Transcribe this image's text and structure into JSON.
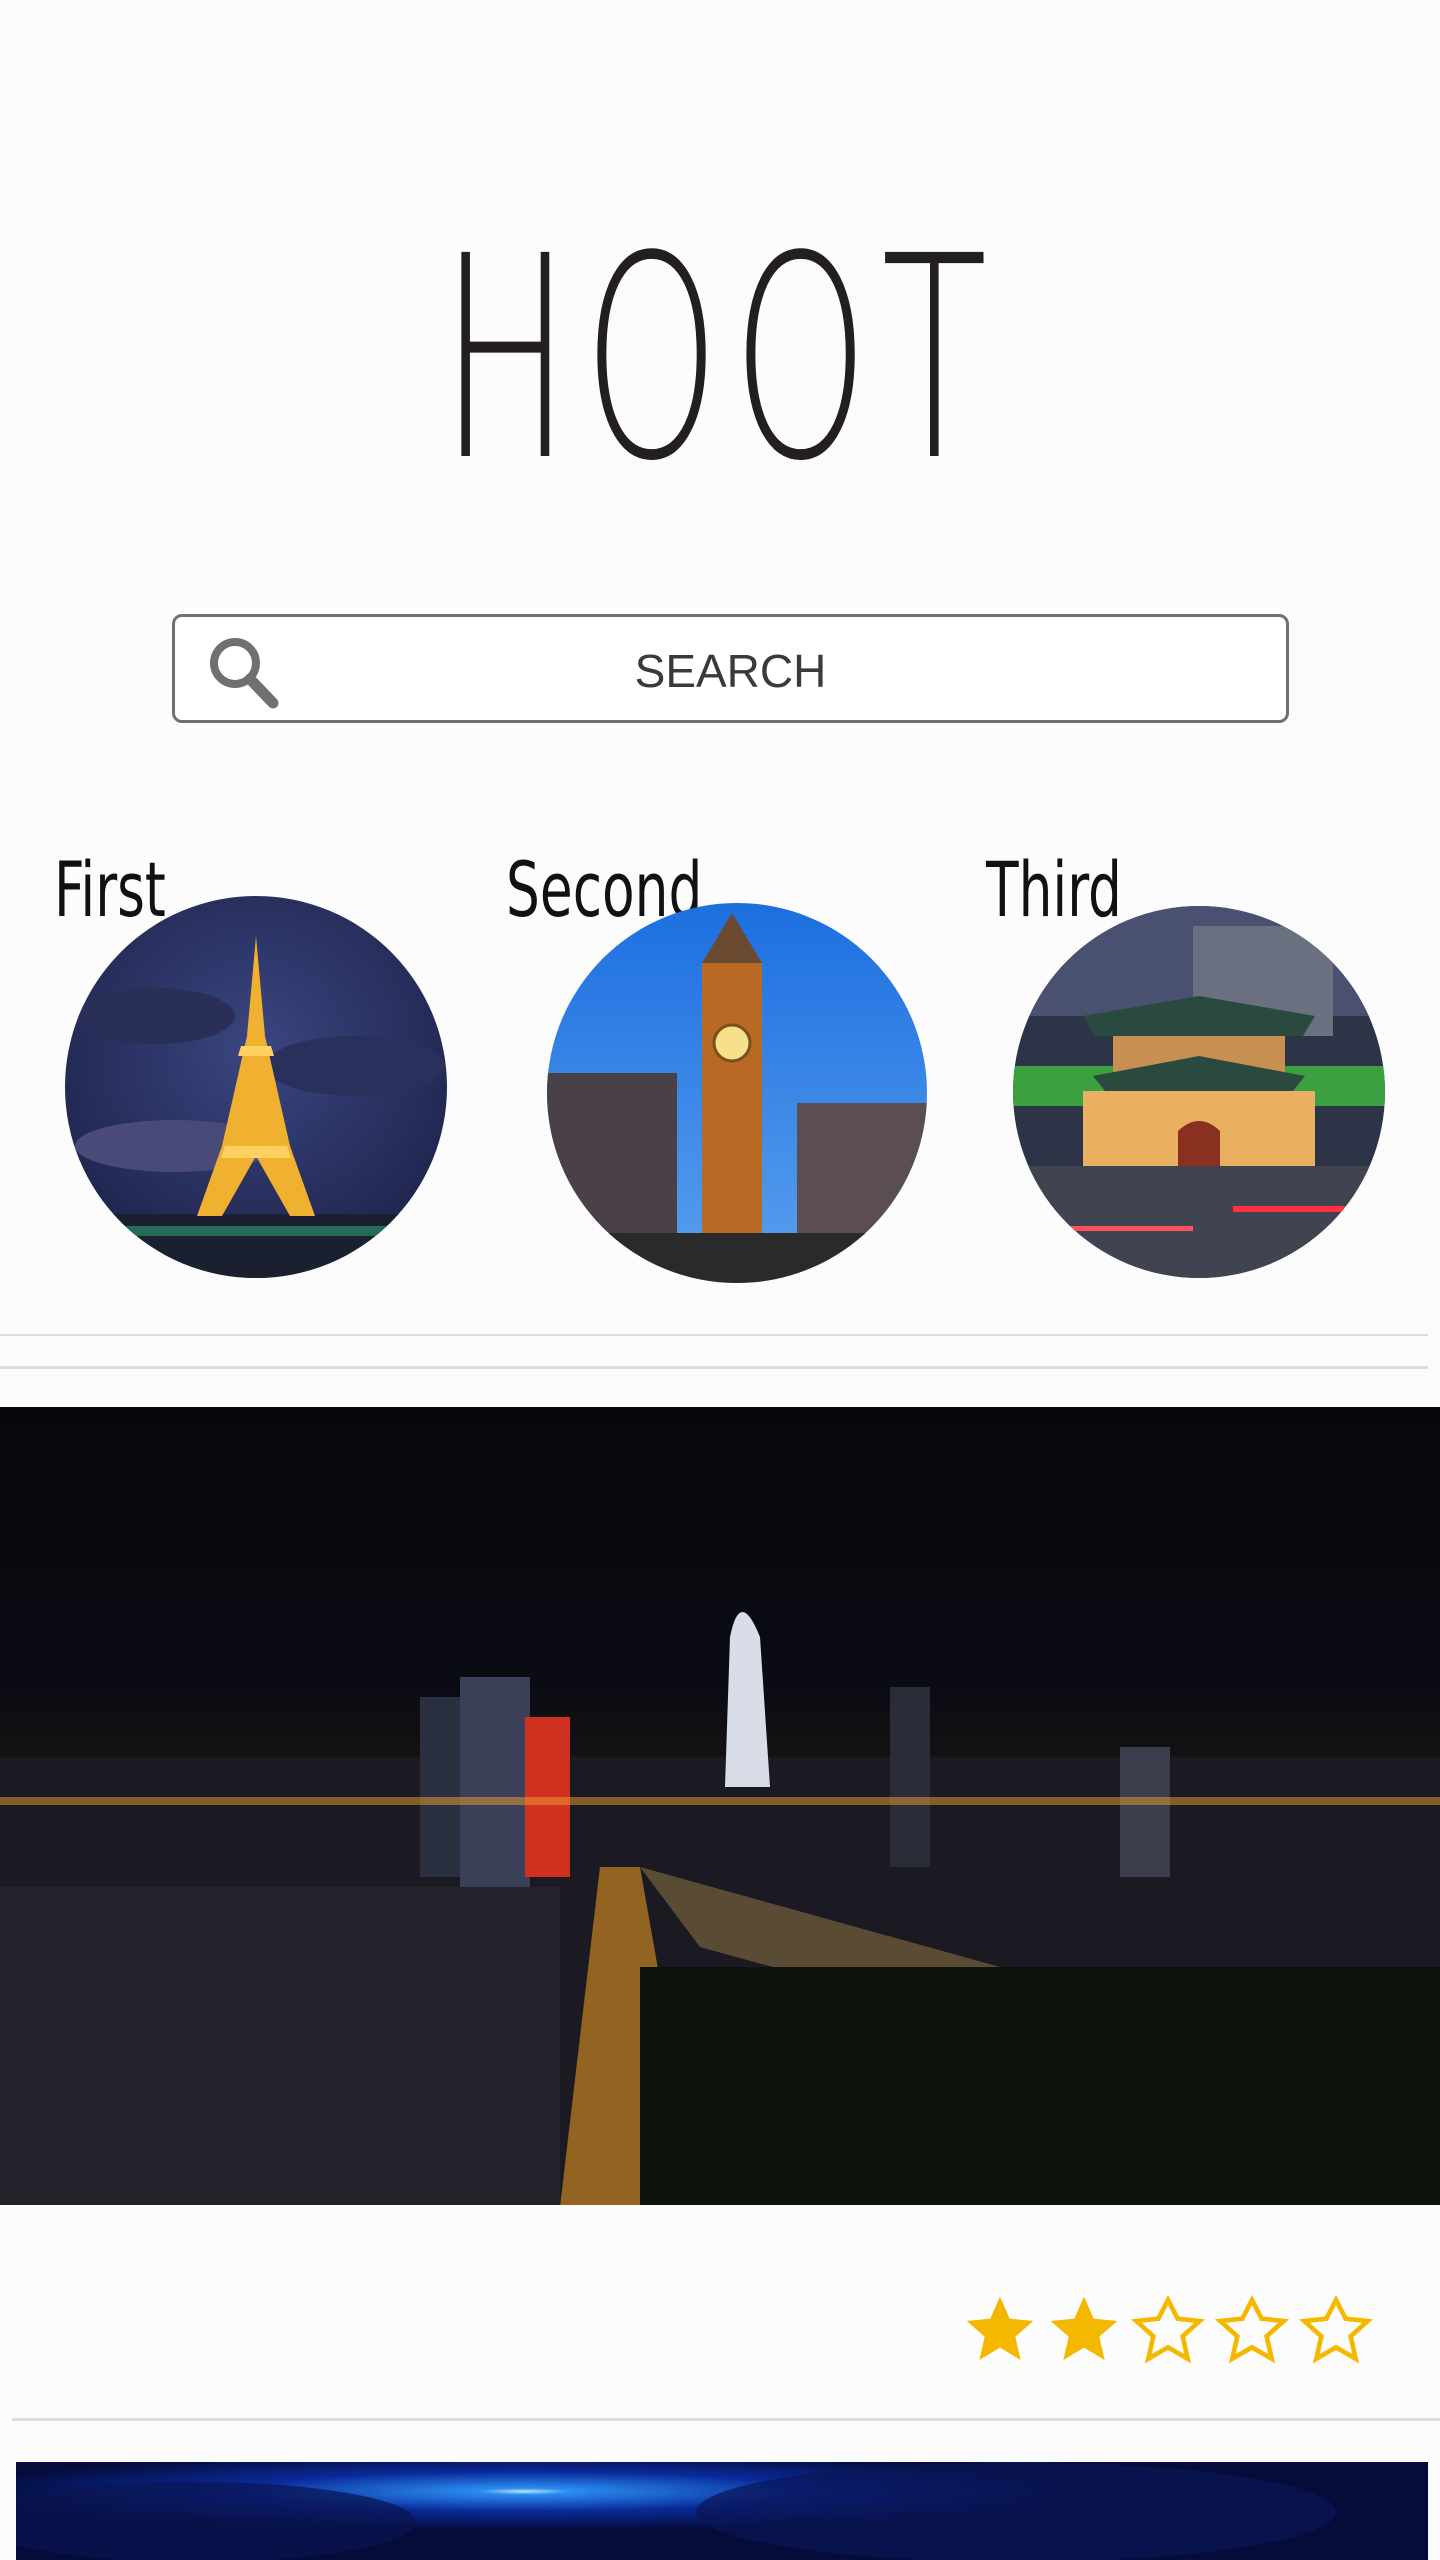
{
  "logo": "HOOT",
  "search": {
    "placeholder": "SEARCH"
  },
  "categories": [
    {
      "label": "First",
      "image": "eiffel-tower-night"
    },
    {
      "label": "Second",
      "image": "big-ben-dusk"
    },
    {
      "label": "Third",
      "image": "dongdaemun-gate-night"
    }
  ],
  "featured": {
    "image": "city-skyline-night",
    "rating": 2,
    "max_rating": 5
  },
  "colors": {
    "star": "#f5b800",
    "text": "#231f20",
    "divider": "#dcdcdc"
  },
  "icons": {
    "search": "magnifier-icon",
    "star_filled": "star-filled-icon",
    "star_empty": "star-outline-icon"
  }
}
